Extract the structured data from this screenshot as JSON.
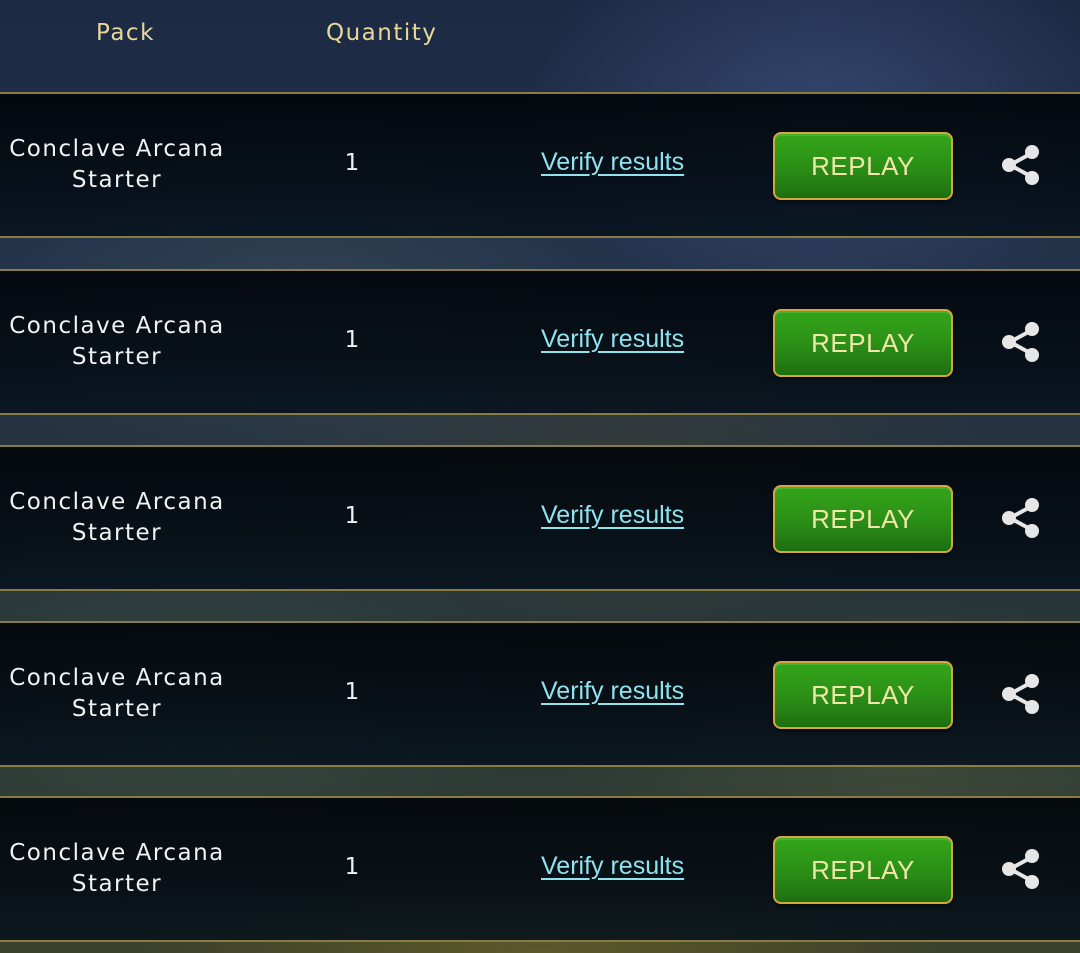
{
  "header": {
    "pack_label": "Pack",
    "quantity_label": "Quantity"
  },
  "rows": [
    {
      "pack_line1": "Conclave Arcana",
      "pack_line2": "Starter",
      "quantity": "1",
      "verify_label": "Verify results",
      "replay_label": "REPLAY",
      "share_icon": "share-icon"
    },
    {
      "pack_line1": "Conclave Arcana",
      "pack_line2": "Starter",
      "quantity": "1",
      "verify_label": "Verify results",
      "replay_label": "REPLAY",
      "share_icon": "share-icon"
    },
    {
      "pack_line1": "Conclave Arcana",
      "pack_line2": "Starter",
      "quantity": "1",
      "verify_label": "Verify results",
      "replay_label": "REPLAY",
      "share_icon": "share-icon"
    },
    {
      "pack_line1": "Conclave Arcana",
      "pack_line2": "Starter",
      "quantity": "1",
      "verify_label": "Verify results",
      "replay_label": "REPLAY",
      "share_icon": "share-icon"
    },
    {
      "pack_line1": "Conclave Arcana",
      "pack_line2": "Starter",
      "quantity": "1",
      "verify_label": "Verify results",
      "replay_label": "REPLAY",
      "share_icon": "share-icon"
    }
  ],
  "colors": {
    "header_text": "#e9d79a",
    "link": "#8fe3ee",
    "button_green": "#2a8e16",
    "button_border": "#d4a93c",
    "button_text": "#f0e7a8",
    "row_border": "#8a7a44"
  }
}
